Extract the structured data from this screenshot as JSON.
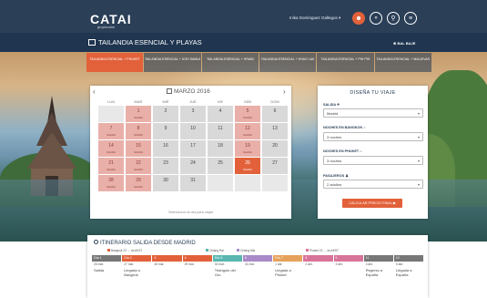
{
  "header": {
    "logo": "CATAI",
    "logo_sub": "grupocatai",
    "user_name": "Inika Domínguez Gallegos ▾",
    "icons": [
      "user-icon",
      "globe-icon",
      "search-icon",
      "menu-icon"
    ]
  },
  "subbar": {
    "title": "TAILANDIA ESENCIAL Y PLAYAS",
    "right": "⊕ BAL BAJE"
  },
  "tabs": [
    {
      "label": "TAILANDIA ESENCIAL + PHUKET",
      "active": true
    },
    {
      "label": "TAILANDIA ESENCIAL + KOH SAMUI",
      "active": false
    },
    {
      "label": "TAILANDIA ESENCIAL + KRABI",
      "active": false
    },
    {
      "label": "TAILANDIA ESENCIAL + KHAO LAK",
      "active": false
    },
    {
      "label": "TAILANDIA ESENCIAL + PHI PHI",
      "active": false
    },
    {
      "label": "TAILANDIA ESENCIAL + MALDIVAS",
      "active": false
    }
  ],
  "calendar": {
    "title": "MARZO 2016",
    "weekdays": [
      "LUN",
      "MAR",
      "MIÉ",
      "JUE",
      "VIE",
      "SÁB",
      "DOM"
    ],
    "cells": [
      {
        "d": "",
        "p": "",
        "s": "empty"
      },
      {
        "d": "1",
        "p": "SALIDA",
        "s": "salida"
      },
      {
        "d": "2",
        "p": "",
        "s": "plain"
      },
      {
        "d": "3",
        "p": "",
        "s": "plain"
      },
      {
        "d": "4",
        "p": "",
        "s": "plain"
      },
      {
        "d": "5",
        "p": "SALIDA",
        "s": "salida"
      },
      {
        "d": "6",
        "p": "",
        "s": "plain"
      },
      {
        "d": "7",
        "p": "SALIDA",
        "s": "salida"
      },
      {
        "d": "8",
        "p": "SALIDA",
        "s": "salida"
      },
      {
        "d": "9",
        "p": "",
        "s": "plain"
      },
      {
        "d": "10",
        "p": "",
        "s": "plain"
      },
      {
        "d": "11",
        "p": "",
        "s": "plain"
      },
      {
        "d": "12",
        "p": "SALIDA",
        "s": "salida"
      },
      {
        "d": "13",
        "p": "",
        "s": "plain"
      },
      {
        "d": "14",
        "p": "SALIDA",
        "s": "salida"
      },
      {
        "d": "15",
        "p": "SALIDA",
        "s": "salida"
      },
      {
        "d": "16",
        "p": "",
        "s": "plain"
      },
      {
        "d": "17",
        "p": "",
        "s": "plain"
      },
      {
        "d": "18",
        "p": "",
        "s": "plain"
      },
      {
        "d": "19",
        "p": "SALIDA",
        "s": "salida"
      },
      {
        "d": "20",
        "p": "",
        "s": "plain"
      },
      {
        "d": "21",
        "p": "SALIDA",
        "s": "salida"
      },
      {
        "d": "22",
        "p": "SALIDA",
        "s": "salida"
      },
      {
        "d": "23",
        "p": "",
        "s": "plain"
      },
      {
        "d": "24",
        "p": "",
        "s": "plain"
      },
      {
        "d": "25",
        "p": "",
        "s": "plain"
      },
      {
        "d": "26",
        "p": "SALIDA",
        "s": "sel"
      },
      {
        "d": "27",
        "p": "",
        "s": "plain"
      },
      {
        "d": "28",
        "p": "SALIDA",
        "s": "salida"
      },
      {
        "d": "29",
        "p": "SALIDA",
        "s": "salida"
      },
      {
        "d": "30",
        "p": "",
        "s": "plain"
      },
      {
        "d": "31",
        "p": "",
        "s": "plain"
      },
      {
        "d": "",
        "p": "",
        "s": "empty"
      },
      {
        "d": "",
        "p": "",
        "s": "empty"
      },
      {
        "d": "",
        "p": "",
        "s": "empty"
      }
    ],
    "note": "Selecciona un día para viajar"
  },
  "booking": {
    "title": "DISEÑA TU VIAJE",
    "fields": [
      {
        "label": "SALIDA ✈",
        "value": "Madrid"
      },
      {
        "label": "NOCHES EN BANGKOK ⌂",
        "value": "3 noches"
      },
      {
        "label": "NOCHES EN PHUKET ⌂",
        "value": "3 noches"
      },
      {
        "label": "PASAJEROS ♟",
        "value": "2 adultos"
      }
    ],
    "button": "CALCULAR PRECIO FINAL ▶"
  },
  "itinerary": {
    "title": "ITINERARIO SALIDA DESDE MADRID",
    "flights": [
      {
        "label": "Bangkok 23 → ok:AKST"
      },
      {
        "label": "Chiang Rai"
      },
      {
        "label": "Chiang Mai"
      },
      {
        "label": "Phuket 23 → ok:AKST"
      }
    ],
    "days": [
      {
        "bar": "Día 1",
        "color": "grey",
        "date": "26 mar.",
        "desc": "Salida"
      },
      {
        "bar": "Día 2",
        "color": "orange",
        "date": "27 mar.",
        "desc": "Llegada a Bangkok"
      },
      {
        "bar": "3",
        "color": "orange",
        "date": "28 mar.",
        "desc": ""
      },
      {
        "bar": "4",
        "color": "orange",
        "date": "29 mar.",
        "desc": ""
      },
      {
        "bar": "Día 5",
        "color": "teal",
        "date": "30 mar.",
        "desc": "Triángulo del Oro"
      },
      {
        "bar": "6",
        "color": "purple",
        "date": "31 mar.",
        "desc": ""
      },
      {
        "bar": "Día 7",
        "color": "tan",
        "date": "1 abr.",
        "desc": "Llegada a Phuket"
      },
      {
        "bar": "8",
        "color": "pink",
        "date": "2 abr.",
        "desc": ""
      },
      {
        "bar": "9",
        "color": "pink",
        "date": "3 abr.",
        "desc": ""
      },
      {
        "bar": "11",
        "color": "grey",
        "date": "4 abr.",
        "desc": "Regreso a España"
      },
      {
        "bar": "12",
        "color": "grey",
        "date": "5 abr.",
        "desc": "Llegada a España"
      }
    ]
  }
}
